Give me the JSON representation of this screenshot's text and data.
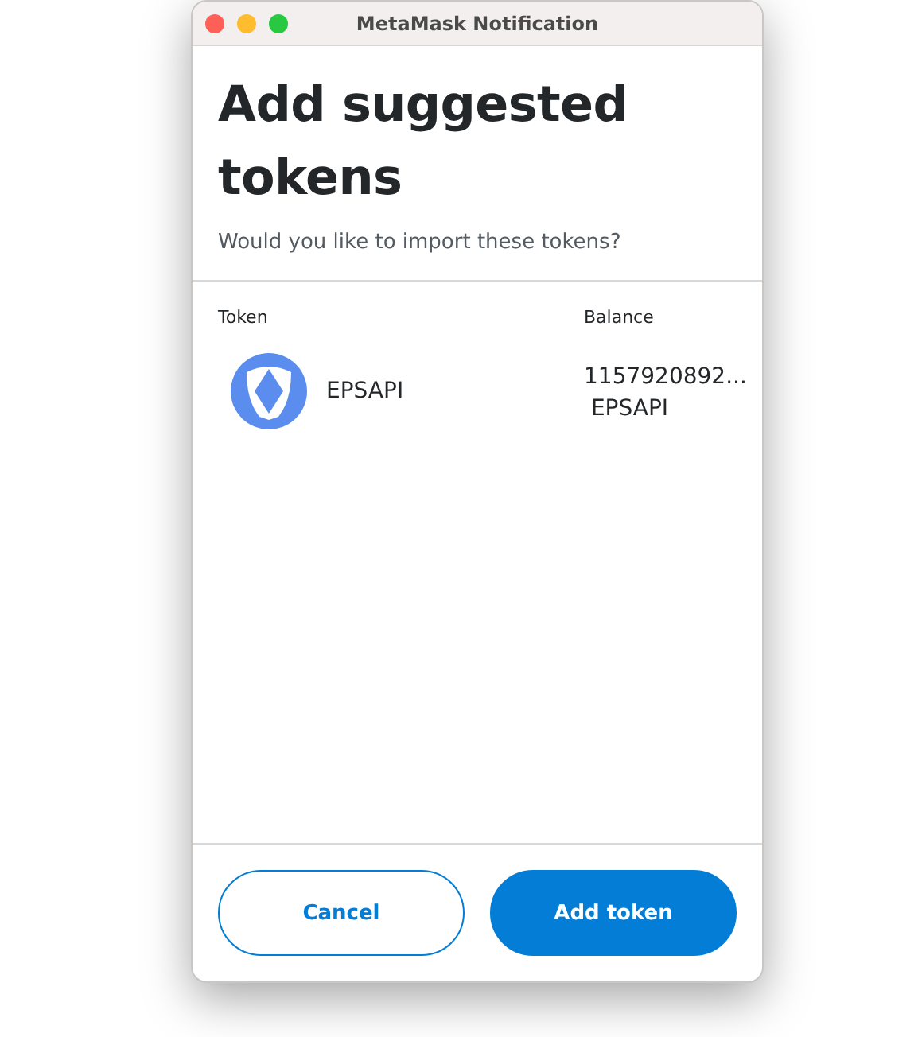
{
  "window": {
    "title": "MetaMask Notification"
  },
  "heading": "Add suggested tokens",
  "subtitle": "Would you like to import these tokens?",
  "table": {
    "columns": [
      "Token",
      "Balance"
    ],
    "rows": [
      {
        "token": "EPSAPI",
        "balance_value": "1157920892...",
        "balance_symbol": "EPSAPI"
      }
    ]
  },
  "buttons": [
    {
      "label": "Cancel",
      "kind": "secondary"
    },
    {
      "label": "Add token",
      "kind": "primary"
    }
  ]
}
